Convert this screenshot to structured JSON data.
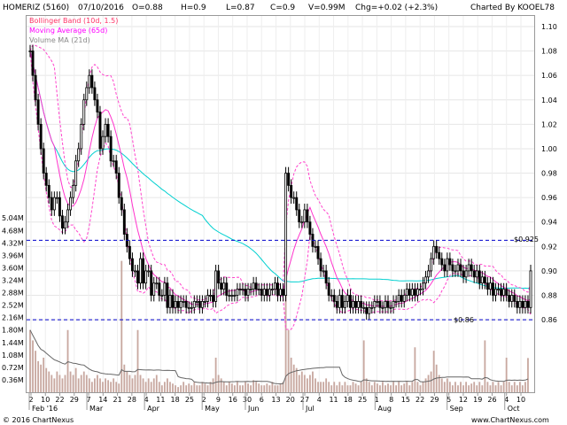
{
  "header": {
    "symbol": "HOMERIZ (5160)",
    "date": "07/10/2016",
    "open": "O=0.88",
    "high": "H=0.9",
    "low": "L=0.87",
    "close": "C=0.9",
    "volume": "V=0.99M",
    "change": "Chg=+0.02 (+2.3%)",
    "charted_by": "Charted By KOOEL78"
  },
  "legend": [
    {
      "label": "Bollinger Band (10d, 1.5)",
      "color": "#ff3366"
    },
    {
      "label": "Moving Average (65d)",
      "color": "#ff00ff"
    },
    {
      "label": "Volume MA (21d)",
      "color": "#888888"
    }
  ],
  "footer": {
    "copyright": "© 2016 ChartNexus",
    "site": "www.ChartNexus.com"
  },
  "colors": {
    "bollinger": "#ff44cc",
    "ma": "#ff33cc",
    "long_ma": "#00d0d0",
    "candle": "#000000",
    "level_line": "#0000cc",
    "volume": "#c8a8a0",
    "volume_ma": "#666666"
  },
  "annotations": {
    "resistance_label": "$0.925",
    "support_label": "$0.86"
  },
  "chart_data": {
    "type": "candlestick",
    "price_axis": {
      "ticks": [
        "1.10",
        "1.08",
        "1.06",
        "1.04",
        "1.02",
        "1.00",
        "0.98",
        "0.96",
        "0.94",
        "0.92",
        "0.90",
        "0.88",
        "0.86"
      ],
      "range": [
        0.855,
        1.1
      ]
    },
    "volume_axis": {
      "ticks": [
        "5.04M",
        "4.68M",
        "4.32M",
        "3.96M",
        "3.60M",
        "3.24M",
        "2.88M",
        "2.52M",
        "2.16M",
        "1.80M",
        "1.44M",
        "1.08M",
        "0.72M",
        "0.36M"
      ],
      "range": [
        0,
        5.2
      ]
    },
    "x_ticks": [
      "2",
      "10",
      "22",
      "29",
      "7",
      "14",
      "21",
      "28",
      "4",
      "11",
      "18",
      "25",
      "2",
      "9",
      "16",
      "30",
      "6",
      "13",
      "20",
      "27",
      "4",
      "11",
      "18",
      "25",
      "1",
      "8",
      "15",
      "22",
      "29",
      "5",
      "12",
      "19",
      "26",
      "4",
      "10"
    ],
    "month_labels": [
      "Feb '16",
      "Mar",
      "Apr",
      "May",
      "Jun",
      "Jul",
      "Aug",
      "Sep",
      "Oct"
    ],
    "levels": [
      0.925,
      0.86
    ],
    "close": [
      1.08,
      1.06,
      1.04,
      1.02,
      1.0,
      0.98,
      0.97,
      0.96,
      0.95,
      0.96,
      0.96,
      0.945,
      0.935,
      0.94,
      0.95,
      0.96,
      0.97,
      0.99,
      1.0,
      1.02,
      1.04,
      1.05,
      1.06,
      1.05,
      1.04,
      1.03,
      1.0,
      1.01,
      1.02,
      1.01,
      0.99,
      0.99,
      0.98,
      0.96,
      0.95,
      0.93,
      0.92,
      0.91,
      0.9,
      0.9,
      0.89,
      0.91,
      0.89,
      0.9,
      0.9,
      0.88,
      0.89,
      0.89,
      0.88,
      0.88,
      0.89,
      0.87,
      0.88,
      0.87,
      0.875,
      0.87,
      0.875,
      0.875,
      0.87,
      0.87,
      0.87,
      0.875,
      0.875,
      0.87,
      0.875,
      0.875,
      0.88,
      0.88,
      0.875,
      0.9,
      0.89,
      0.885,
      0.89,
      0.88,
      0.88,
      0.88,
      0.88,
      0.885,
      0.885,
      0.885,
      0.88,
      0.885,
      0.885,
      0.89,
      0.885,
      0.885,
      0.88,
      0.885,
      0.88,
      0.885,
      0.885,
      0.89,
      0.88,
      0.885,
      0.88,
      0.98,
      0.97,
      0.96,
      0.96,
      0.95,
      0.94,
      0.94,
      0.95,
      0.94,
      0.93,
      0.92,
      0.92,
      0.91,
      0.9,
      0.9,
      0.89,
      0.88,
      0.88,
      0.875,
      0.87,
      0.88,
      0.87,
      0.875,
      0.88,
      0.87,
      0.875,
      0.87,
      0.875,
      0.87,
      0.87,
      0.865,
      0.87,
      0.87,
      0.875,
      0.875,
      0.87,
      0.87,
      0.875,
      0.87,
      0.87,
      0.875,
      0.875,
      0.88,
      0.875,
      0.88,
      0.885,
      0.88,
      0.885,
      0.88,
      0.885,
      0.885,
      0.89,
      0.895,
      0.9,
      0.91,
      0.92,
      0.915,
      0.91,
      0.905,
      0.9,
      0.91,
      0.905,
      0.9,
      0.9,
      0.905,
      0.9,
      0.895,
      0.9,
      0.905,
      0.9,
      0.895,
      0.9,
      0.89,
      0.895,
      0.89,
      0.885,
      0.89,
      0.88,
      0.885,
      0.885,
      0.88,
      0.885,
      0.88,
      0.875,
      0.88,
      0.875,
      0.87,
      0.875,
      0.87,
      0.875,
      0.87,
      0.9
    ],
    "volume_millions": [
      1.8,
      1.5,
      1.2,
      0.9,
      0.8,
      1.0,
      0.7,
      0.6,
      0.5,
      0.4,
      0.6,
      0.5,
      0.4,
      0.5,
      1.8,
      0.6,
      0.5,
      0.7,
      0.4,
      0.5,
      0.6,
      0.5,
      0.4,
      0.3,
      0.4,
      0.5,
      0.4,
      0.3,
      0.4,
      0.35,
      0.3,
      0.4,
      0.3,
      0.25,
      3.8,
      0.8,
      0.6,
      0.5,
      0.4,
      0.5,
      1.8,
      0.5,
      0.4,
      0.3,
      0.4,
      0.3,
      0.4,
      0.5,
      0.3,
      0.2,
      0.3,
      0.4,
      0.3,
      0.25,
      0.2,
      0.15,
      0.2,
      0.3,
      0.2,
      0.25,
      0.2,
      0.3,
      0.2,
      0.2,
      0.3,
      0.25,
      0.2,
      0.3,
      0.4,
      1.0,
      0.5,
      0.4,
      0.3,
      0.2,
      0.3,
      0.25,
      0.2,
      0.3,
      0.2,
      0.2,
      0.3,
      0.25,
      0.2,
      0.35,
      0.3,
      0.25,
      0.2,
      0.2,
      0.25,
      0.2,
      0.3,
      0.2,
      0.2,
      0.25,
      0.3,
      4.8,
      1.8,
      1.0,
      0.8,
      0.7,
      0.5,
      0.6,
      0.5,
      0.4,
      0.5,
      0.6,
      0.4,
      0.3,
      0.3,
      0.3,
      0.4,
      0.3,
      0.2,
      0.3,
      0.2,
      0.3,
      0.2,
      0.3,
      0.2,
      0.2,
      0.3,
      0.25,
      0.2,
      0.3,
      1.5,
      0.4,
      0.3,
      0.2,
      0.3,
      0.25,
      0.2,
      0.3,
      0.2,
      0.25,
      0.2,
      0.3,
      0.2,
      0.3,
      0.2,
      0.25,
      0.3,
      0.2,
      0.3,
      1.3,
      0.3,
      0.2,
      0.3,
      0.4,
      0.5,
      0.6,
      1.2,
      0.8,
      0.5,
      0.4,
      0.3,
      0.4,
      0.3,
      0.2,
      0.3,
      0.2,
      0.3,
      0.2,
      0.3,
      0.2,
      0.25,
      0.3,
      0.2,
      0.3,
      0.2,
      1.5,
      0.3,
      0.2,
      0.3,
      0.2,
      0.3,
      0.2,
      0.3,
      1.0,
      0.3,
      0.2,
      0.3,
      0.2,
      0.3,
      0.2,
      0.3,
      0.99
    ]
  }
}
